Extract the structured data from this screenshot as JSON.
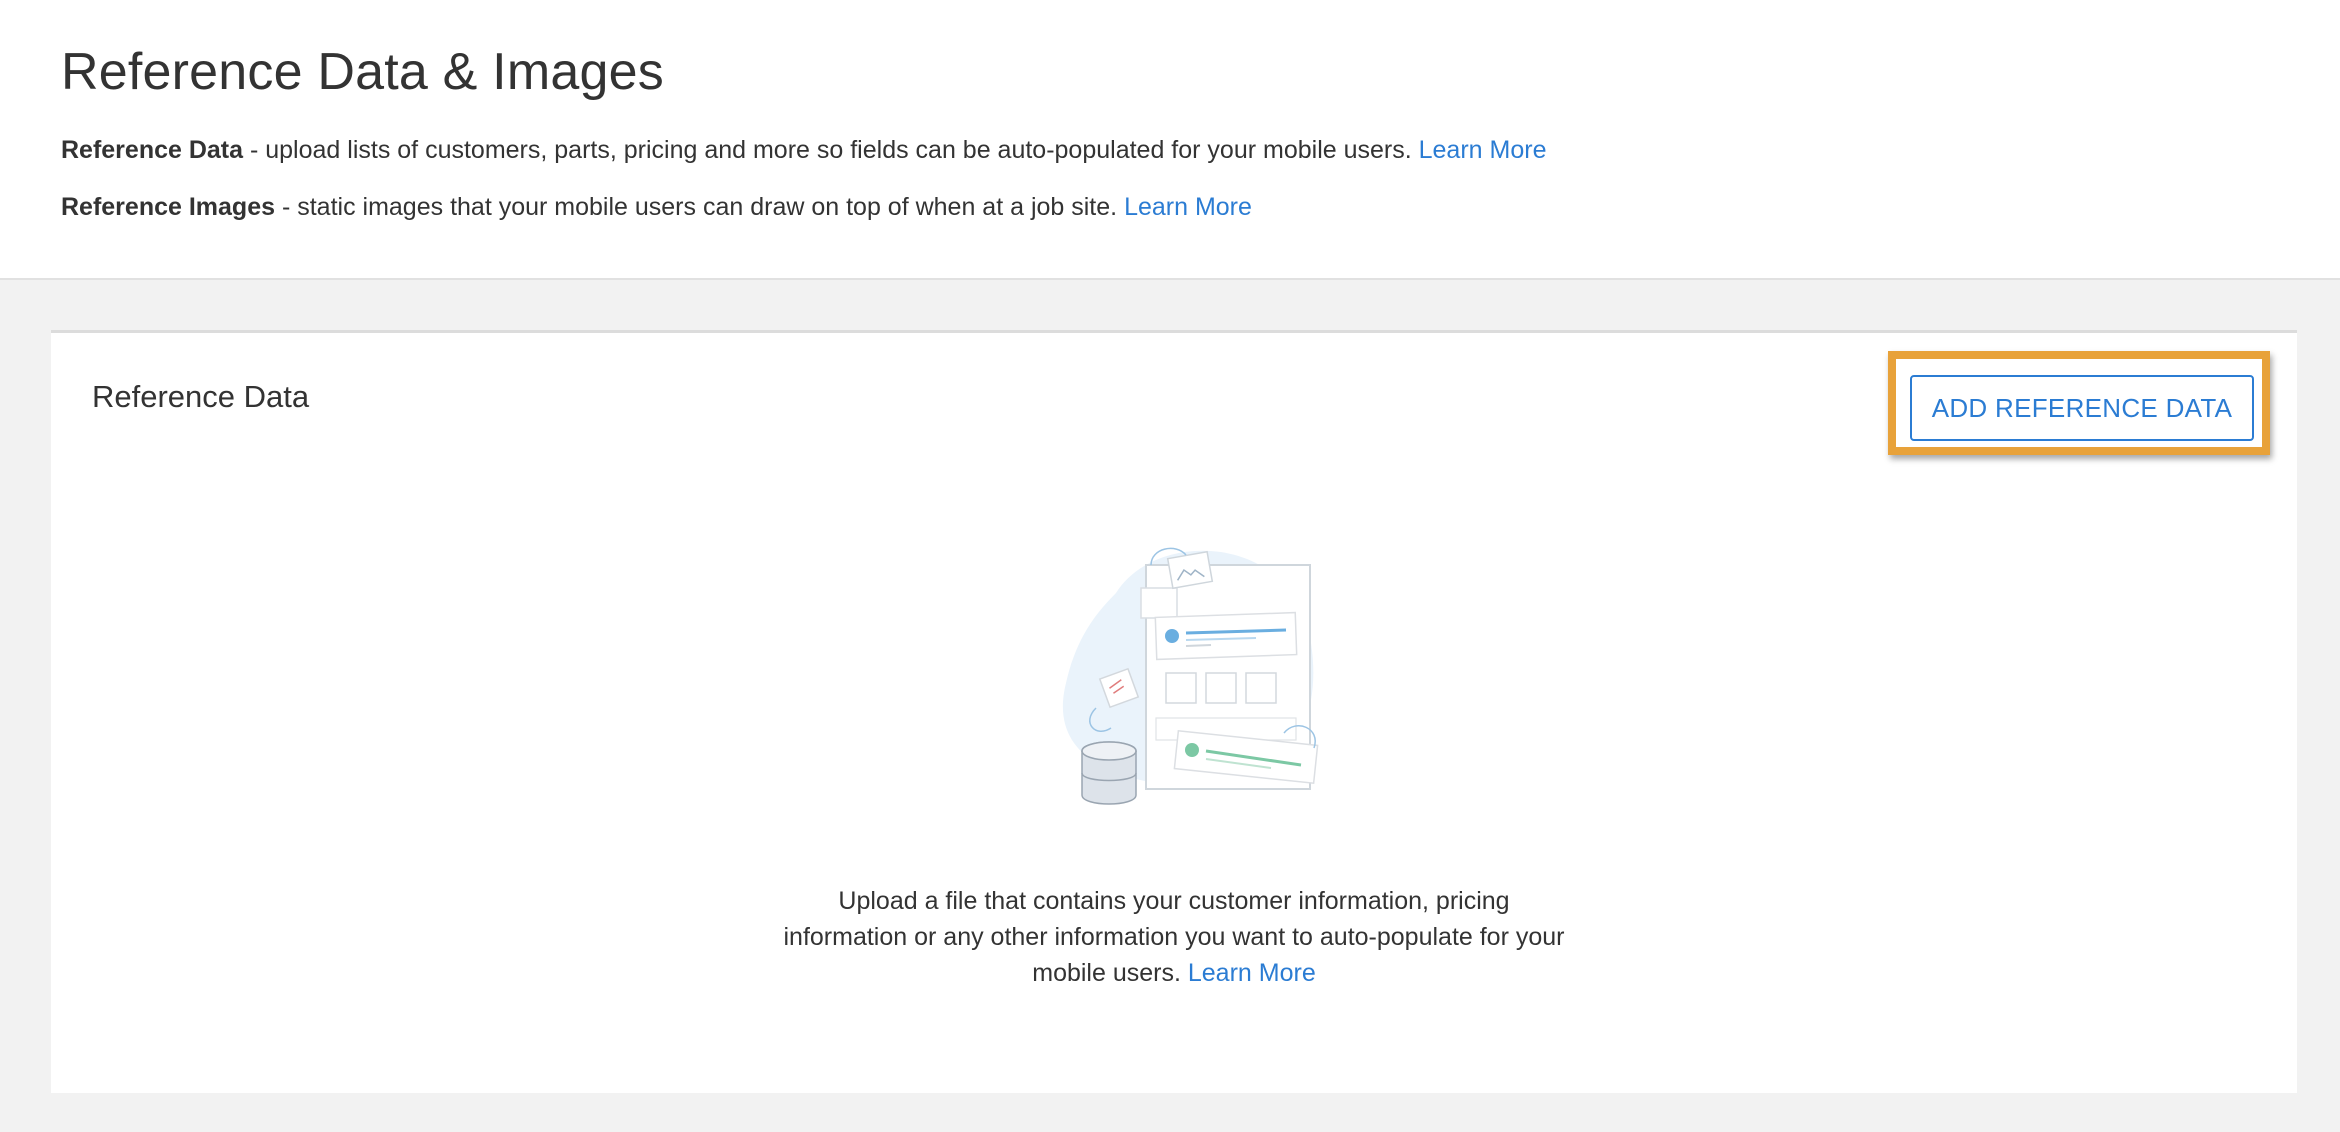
{
  "header": {
    "title": "Reference Data & Images",
    "reference_data": {
      "term": "Reference Data",
      "description": " - upload lists of customers, parts, pricing and more so fields can be auto-populated for your mobile users. ",
      "link": "Learn More"
    },
    "reference_images": {
      "term": "Reference Images",
      "description": " - static images that your mobile users can draw on top of when at a job site. ",
      "link": "Learn More"
    }
  },
  "card": {
    "title": "Reference Data",
    "add_button_label": "ADD REFERENCE DATA",
    "empty_state": {
      "illustration_icon": "reference-data-illustration",
      "text": "Upload a file that contains your customer information, pricing information or any other information you want to auto-populate for your mobile users. ",
      "link": "Learn More"
    }
  },
  "colors": {
    "accent": "#2b7cd3",
    "highlight": "#e8a23a",
    "background": "#f2f2f2"
  }
}
